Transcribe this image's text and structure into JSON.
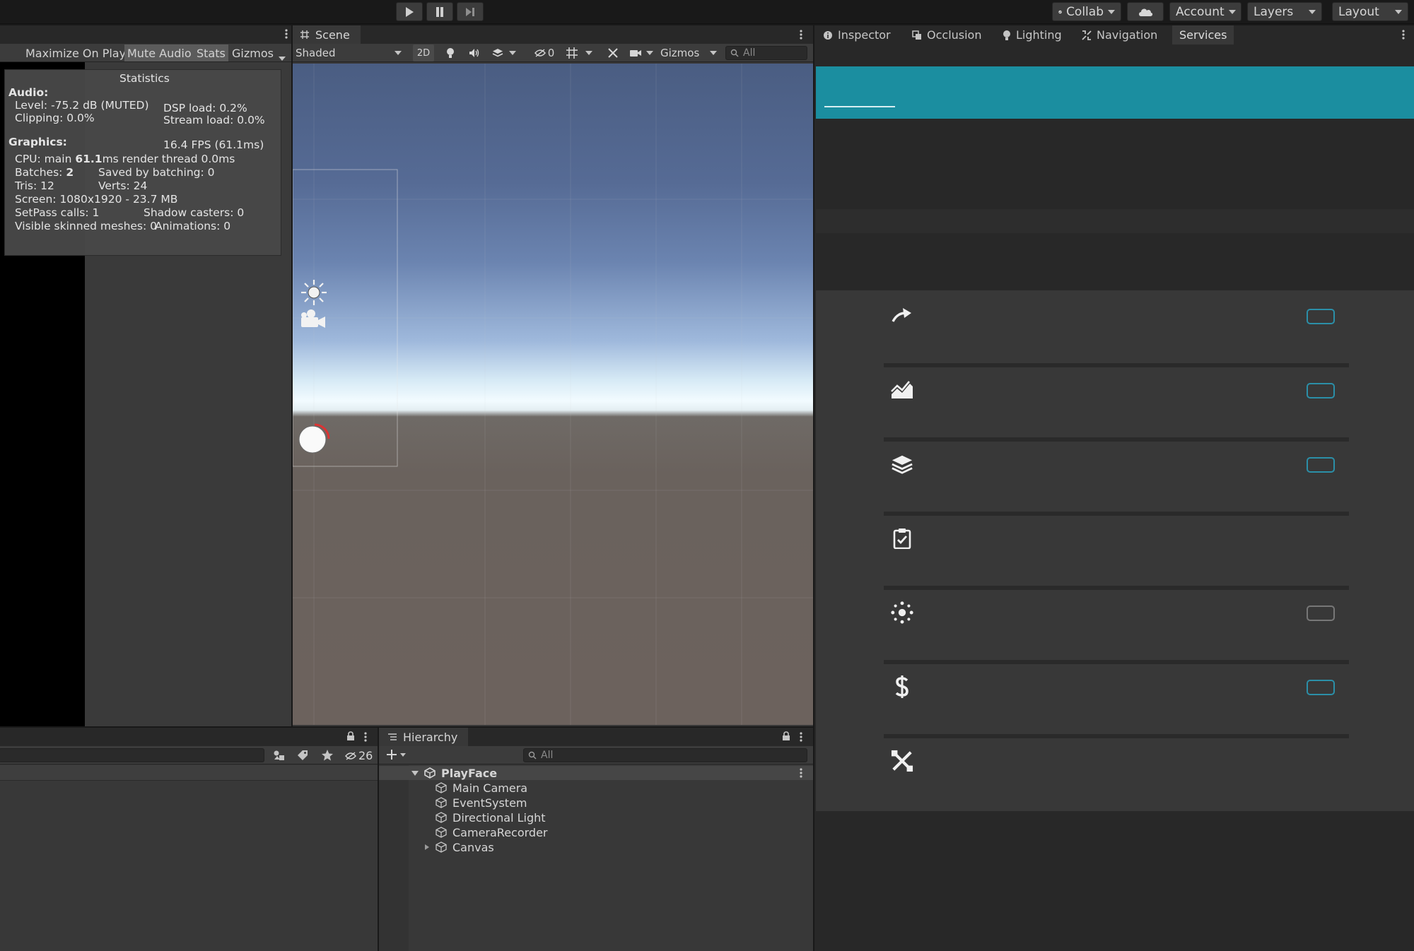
{
  "toolbar": {
    "collab_label": "Collab",
    "account_label": "Account",
    "layers_label": "Layers",
    "layout_label": "Layout",
    "icons": [
      "play-icon",
      "pause-icon",
      "step-icon",
      "check-icon",
      "cloud-icon"
    ]
  },
  "game": {
    "buttons": {
      "maximize": "Maximize On Play",
      "mute": "Mute Audio",
      "stats": "Stats",
      "gizmos": "Gizmos"
    },
    "statistics": {
      "title": "Statistics",
      "audio_header": "Audio:",
      "level": "Level: -75.2 dB (MUTED)",
      "clipping": "Clipping: 0.0%",
      "dsp_load": "DSP load: 0.2%",
      "stream_load": "Stream load: 0.0%",
      "graphics_header": "Graphics:",
      "fps": "16.4 FPS (61.1ms)",
      "cpu_prefix": "CPU: main ",
      "cpu_main": "61.1",
      "cpu_suffix": "ms  render thread 0.0ms",
      "batches_prefix": "Batches: ",
      "batches": "2",
      "saved_batching": "Saved by batching: 0",
      "tris": "Tris: 12",
      "verts": "Verts: 24",
      "screen": "Screen: 1080x1920 - 23.7 MB",
      "setpass": "SetPass calls: 1",
      "shadow_casters": "Shadow casters: 0",
      "skinned": "Visible skinned meshes: 0",
      "animations": "Animations: 0"
    }
  },
  "scene": {
    "tab_label": "Scene",
    "shading_mode": "Shaded",
    "mode_2d": "2D",
    "hidden_count": "0",
    "gizmos_label": "Gizmos",
    "search_placeholder": "All"
  },
  "right_panel": {
    "tabs": [
      "Inspector",
      "Occlusion",
      "Lighting",
      "Navigation",
      "Services"
    ],
    "services": [
      {
        "icon": "collaborate-arrow-icon",
        "toggle": "on"
      },
      {
        "icon": "analytics-chart-icon",
        "toggle": "on"
      },
      {
        "icon": "layers-stack-icon",
        "toggle": "on"
      },
      {
        "icon": "clipboard-check-icon",
        "toggle": "none"
      },
      {
        "icon": "multiplayer-hub-icon",
        "toggle": "off"
      },
      {
        "icon": "dollar-icon",
        "toggle": "on"
      },
      {
        "icon": "crossed-tools-icon",
        "toggle": "none"
      }
    ]
  },
  "project": {
    "hidden_count": "26"
  },
  "hierarchy": {
    "tab_label": "Hierarchy",
    "search_placeholder": "All",
    "scene_name": "PlayFace",
    "items": [
      "Main Camera",
      "EventSystem",
      "Directional Light",
      "CameraRecorder",
      "Canvas"
    ]
  },
  "colors": {
    "accent_teal": "#1b8ea0",
    "toggle_blue": "#2b8fa8"
  }
}
